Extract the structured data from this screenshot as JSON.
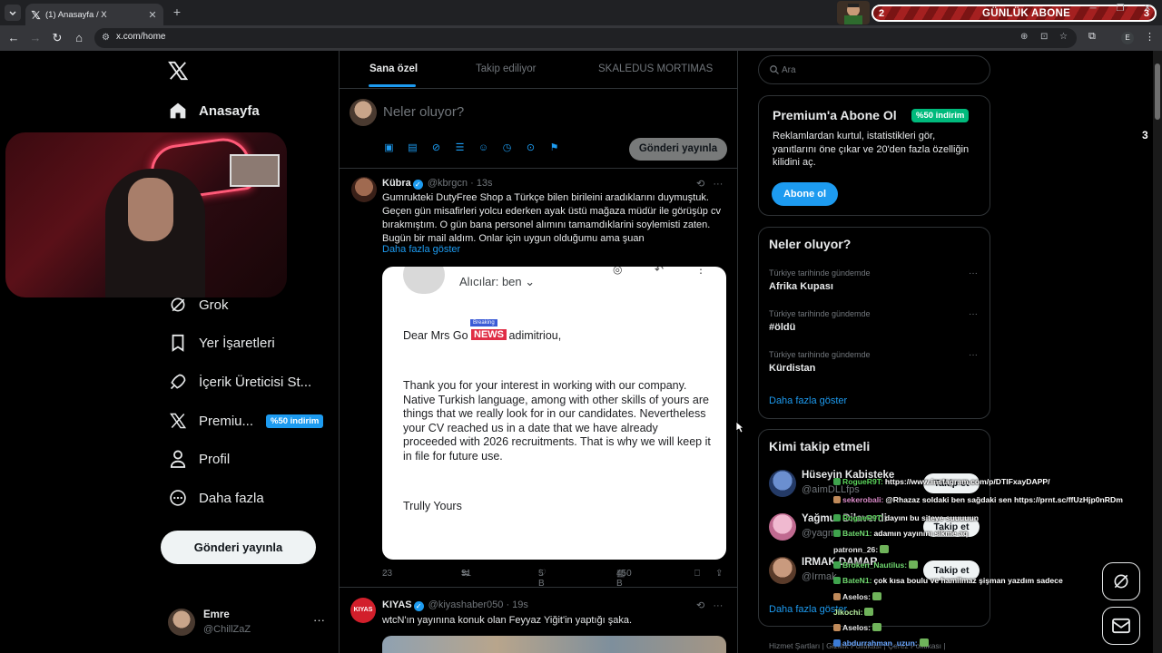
{
  "browser": {
    "tab_title": "(1) Anasayfa / X",
    "url": "x.com/home",
    "profile_initial": "E"
  },
  "stream_overlay": {
    "sub_left": "2",
    "sub_label": "GÜNLÜK ABONE",
    "sub_right": "3",
    "side_number": "3"
  },
  "nav": {
    "home": "Anasayfa",
    "grok": "Grok",
    "bookmarks": "Yer İşaretleri",
    "creator": "İçerik Üreticisi St...",
    "premium": "Premiu...",
    "premium_badge": "%50 indirim",
    "profile": "Profil",
    "more": "Daha fazla",
    "post_button": "Gönderi yayınla",
    "account_name": "Emre",
    "account_handle": "@ChillZaZ"
  },
  "timeline": {
    "tabs": [
      "Sana özel",
      "Takip ediliyor",
      "SKALEDUS MORTIMAS"
    ],
    "compose_placeholder": "Neler oluyor?",
    "compose_button": "Gönderi yayınla",
    "tweets": [
      {
        "name": "Kübra",
        "handle": "@kbrgcn",
        "time": "· 13s",
        "text": "Gumrukteki DutyFree Shop a Türkçe bilen birileini aradıklarını duymuştuk. Geçen gün misafirleri yolcu ederken ayak üstü mağaza müdür ile görüşüp cv bırakmıştım. O gün bana personel alımını tamamdıklarini soylemisti zaten. Bugün bir mail aldım. Onlar için uygun olduğumu ama şuan",
        "show_more": "Daha fazla göster",
        "email": {
          "recipients": "Alıcılar: ben",
          "greeting_start": "Dear Mrs Go",
          "greeting_end": "adimitriou,",
          "news_top": "Breaking",
          "news_main": "NEWS",
          "body": "Thank you for your interest in working with our company. Native Turkish language, among with other skills of yours are things that we really look for in our candidates. Nevertheless your CV reached us in a date that we have already proceeded with 2026 recruitments. That is why we will keep it in file for future use.",
          "signoff": "Trully Yours"
        },
        "replies": "23",
        "reposts": "31",
        "likes": "5 B",
        "views": "450 B"
      },
      {
        "name": "KIYAS",
        "handle": "@kiyashaber050",
        "time": "· 19s",
        "avatar_text": "KIYAS",
        "text": "wtcN'ın yayınına konuk olan Feyyaz Yiğit'in yaptığı şaka."
      }
    ]
  },
  "sidebar": {
    "search_placeholder": "Ara",
    "premium": {
      "title": "Premium'a Abone Ol",
      "badge": "%50 indirim",
      "desc": "Reklamlardan kurtul, istatistikleri gör, yanıtlarını öne çıkar ve 20'den fazla özelliğin kilidini aç.",
      "button": "Abone ol"
    },
    "trends": {
      "title": "Neler oluyor?",
      "items": [
        {
          "context": "Türkiye tarihinde gündemde",
          "topic": "Afrika Kupası"
        },
        {
          "context": "Türkiye tarihinde gündemde",
          "topic": "#öldü"
        },
        {
          "context": "Türkiye tarihinde gündemde",
          "topic": "Kürdistan"
        }
      ],
      "more": "Daha fazla göster"
    },
    "who_to_follow": {
      "title": "Kimi takip etmeli",
      "items": [
        {
          "name": "Hüseyin Kabisteke",
          "handle": "@aimDLLfps",
          "button": "Takip et"
        },
        {
          "name": "Yağmur Dilaverdi",
          "handle": "@yagm",
          "button": "Takip et"
        },
        {
          "name": "IRMAK DAMAR",
          "handle": "@Irmak",
          "button": "Takip et"
        }
      ],
      "more": "Daha fazla göster"
    },
    "footer": "Hizmet Şartları  |  Gizlilik Politikası  |  Çerez Politikası  |"
  },
  "chat": [
    {
      "user": "RogueR9T:",
      "msg": "https://www.instagram.com/p/DTlFxayDAPP/",
      "color": "#5bd65b"
    },
    {
      "user": "sekerobali:",
      "msg": "@Rhazaz soldaki ben sağdaki sen https://prnt.sc/ffUzHjp0nRDm",
      "color": "#d98ac7"
    },
    {
      "user": "RogueR9T:",
      "msg": "dayını bu siteye suuuuun",
      "color": "#5bd65b"
    },
    {
      "user": "BateN1:",
      "msg": "adamın yayınını sikme aq",
      "color": "#6fd86f"
    },
    {
      "user": "patronn_26:",
      "msg": "",
      "color": "#e6e6e6"
    },
    {
      "user": "Broken_Nautilus:",
      "msg": "",
      "color": "#6fd86f"
    },
    {
      "user": "BateN1:",
      "msg": "çok kısa boulu ve hamilmaz şişman yazdım sadece",
      "color": "#6fd86f"
    },
    {
      "user": "Aselos:",
      "msg": "",
      "color": "#e6e6e6"
    },
    {
      "user": "Jikochi:",
      "msg": "",
      "color": "#b8f0a0"
    },
    {
      "user": "Aselos:",
      "msg": "",
      "color": "#e6e6e6"
    },
    {
      "user": "abdurrahman_uzun:",
      "msg": "",
      "color": "#6aa7ff"
    }
  ],
  "colors": {
    "accent": "#1d9bf0",
    "success": "#00ba7c",
    "background": "#000000",
    "border": "#2f3336"
  }
}
